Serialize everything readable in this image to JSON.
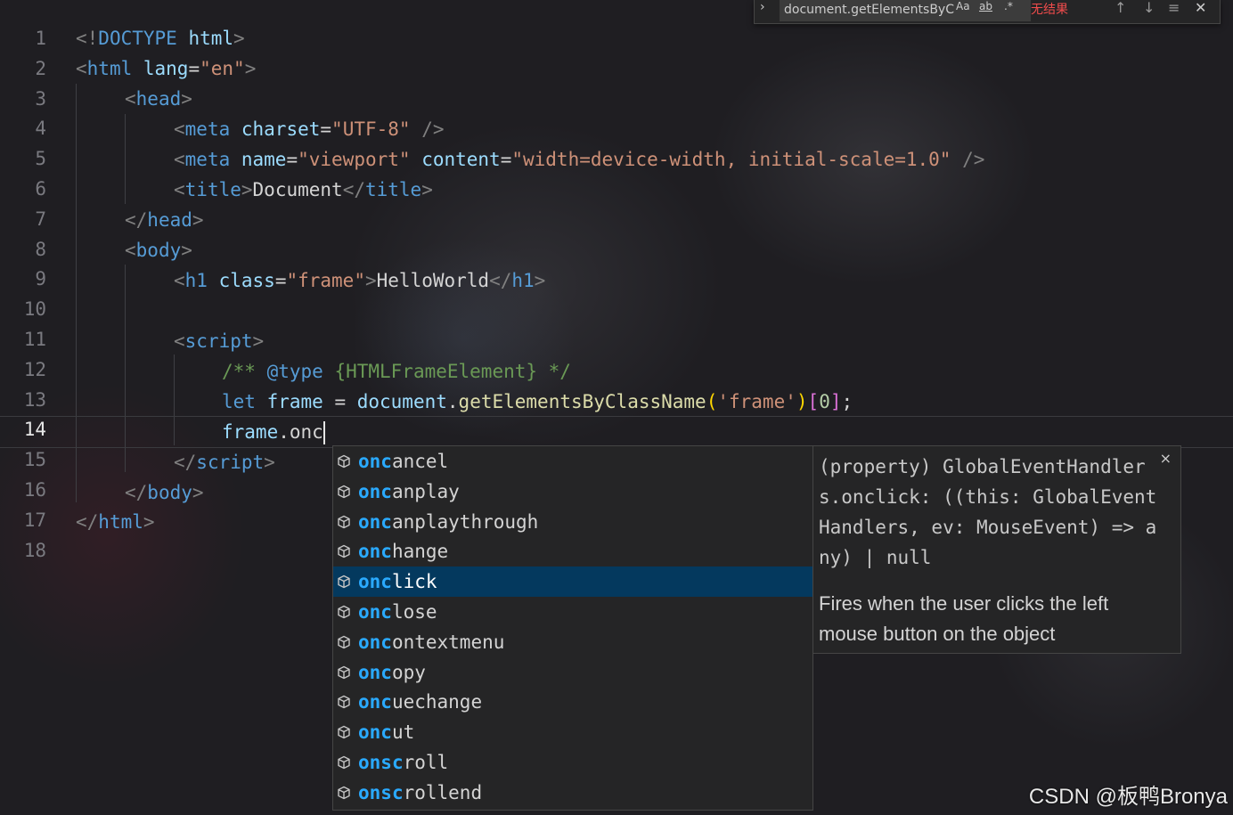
{
  "find_widget": {
    "toggle_glyph": "›",
    "query": "document.getElementsByC",
    "opt_case": "Aa",
    "opt_word": "ab",
    "opt_regex": ".*",
    "result": "无结果",
    "prev_glyph": "↑",
    "next_glyph": "↓",
    "selection_glyph": "≡",
    "close_glyph": "✕"
  },
  "editor": {
    "active_line": 14,
    "line_numbers": [
      "1",
      "2",
      "3",
      "4",
      "5",
      "6",
      "7",
      "8",
      "9",
      "10",
      "11",
      "12",
      "13",
      "14",
      "15",
      "16",
      "17",
      "18"
    ],
    "l1": {
      "a": "<!",
      "b": "DOCTYPE",
      "c": " html",
      "d": ">"
    },
    "l2": {
      "a": "<",
      "b": "html",
      "c": " lang",
      "d": "=",
      "e": "\"en\"",
      "f": ">"
    },
    "l3": {
      "a": "<",
      "b": "head",
      "c": ">"
    },
    "l4": {
      "a": "<",
      "b": "meta",
      "c": " charset",
      "d": "=",
      "e": "\"UTF-8\"",
      "f": " />"
    },
    "l5": {
      "a": "<",
      "b": "meta",
      "c": " name",
      "d": "=",
      "e": "\"viewport\"",
      "f": " content",
      "g": "=",
      "h": "\"width=device-width, initial-scale=1.0\"",
      "i": " />"
    },
    "l6": {
      "a": "<",
      "b": "title",
      "c": ">",
      "d": "Document",
      "e": "</",
      "f": "title",
      "g": ">"
    },
    "l7": {
      "a": "</",
      "b": "head",
      "c": ">"
    },
    "l8": {
      "a": "<",
      "b": "body",
      "c": ">"
    },
    "l9": {
      "a": "<",
      "b": "h1",
      "c": " class",
      "d": "=",
      "e": "\"frame\"",
      "f": ">",
      "g": "HelloWorld",
      "h": "</",
      "i": "h1",
      "j": ">"
    },
    "l11": {
      "a": "<",
      "b": "script",
      "c": ">"
    },
    "l12": {
      "a": "/** ",
      "b": "@type",
      "c": " {HTMLFrameElement} */"
    },
    "l13": {
      "a": "let",
      "b": " frame",
      "c": " = ",
      "d": "document",
      "e": ".",
      "f": "getElementsByClassName",
      "g": "(",
      "h": "'frame'",
      "i": ")",
      "j": "[",
      "k": "0",
      "l": "]",
      "m": ";"
    },
    "l14": {
      "a": "frame",
      "b": ".onc"
    },
    "l15": {
      "a": "</",
      "b": "script",
      "c": ">"
    },
    "l16": {
      "a": "</",
      "b": "body",
      "c": ">"
    },
    "l17": {
      "a": "</",
      "b": "html",
      "c": ">"
    }
  },
  "suggest": {
    "typed_prefix": "onc",
    "selected_index": 4,
    "items": [
      {
        "match": "onc",
        "rest": "ancel"
      },
      {
        "match": "onc",
        "rest": "anplay"
      },
      {
        "match": "onc",
        "rest": "anplaythrough"
      },
      {
        "match": "onc",
        "rest": "hange"
      },
      {
        "match": "onc",
        "rest": "lick"
      },
      {
        "match": "onc",
        "rest": "lose"
      },
      {
        "match": "onc",
        "rest": "ontextmenu"
      },
      {
        "match": "onc",
        "rest": "opy"
      },
      {
        "match": "onc",
        "rest": "uechange"
      },
      {
        "match": "onc",
        "rest": "ut"
      },
      {
        "match": "ons",
        "mid": "c",
        "rest": "roll"
      },
      {
        "match": "ons",
        "mid": "c",
        "rest": "rollend"
      }
    ],
    "item_icon": "property-icon"
  },
  "details": {
    "signature": "(property) GlobalEventHandlers.onclick: ((this: GlobalEventHandlers, ev: MouseEvent) => any) | null",
    "doc": "Fires when the user clicks the left mouse button on the object",
    "close_glyph": "×"
  },
  "watermark": "CSDN @板鸭Bronya",
  "colors": {
    "background": "#1f1e22",
    "tag": "#569cd6",
    "attr": "#9cdcfe",
    "string": "#ce9178",
    "function": "#dcdcaa",
    "comment": "#6a9955",
    "match_highlight": "#2aaaff",
    "selection": "#04395e",
    "no_results": "#f14c4c"
  }
}
